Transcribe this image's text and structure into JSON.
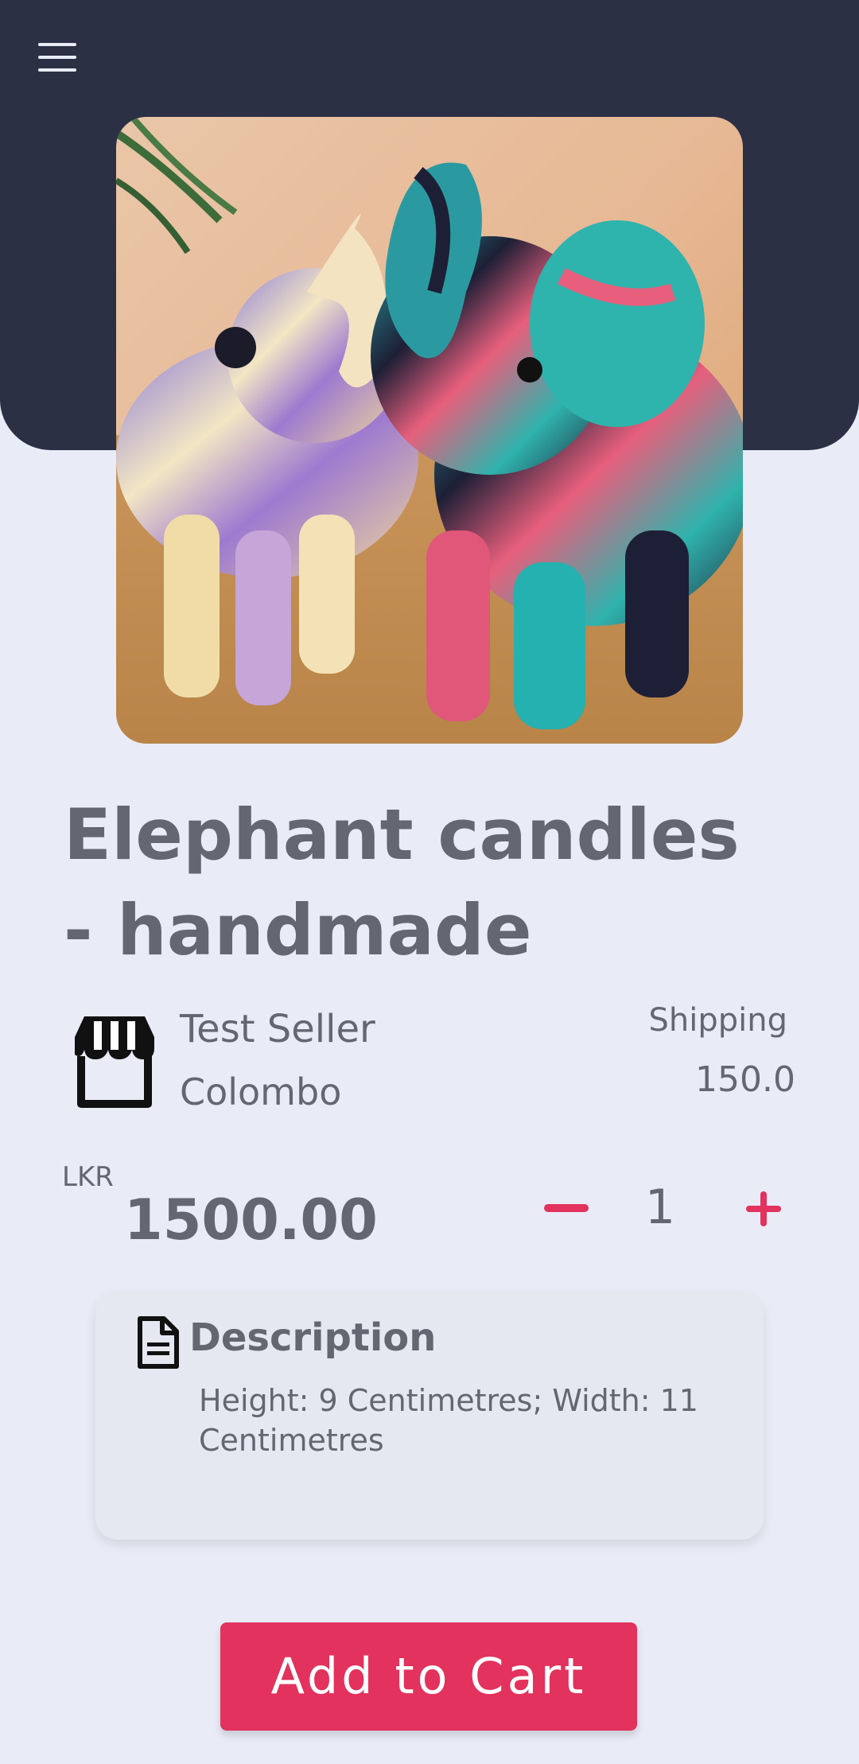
{
  "header": {
    "menu_icon": "hamburger-menu-icon",
    "background_color": "#2c3045"
  },
  "product": {
    "image_alt": "Two colorful marbled elephant candles",
    "title": "Elephant candles - handmade"
  },
  "seller": {
    "icon": "store-icon",
    "name": "Test Seller",
    "city": "Colombo"
  },
  "shipping": {
    "label": "Shipping",
    "value": "150.0"
  },
  "price": {
    "currency": "LKR",
    "amount": "1500.00"
  },
  "quantity": {
    "decrement_icon": "minus-icon",
    "value": "1",
    "increment_icon": "plus-icon"
  },
  "description": {
    "icon": "document-icon",
    "title": "Description",
    "text": "Height: 9 Centimetres; Width: 11 Centimetres"
  },
  "actions": {
    "add_to_cart_label": "Add to Cart",
    "accent_color": "#e2325d"
  }
}
